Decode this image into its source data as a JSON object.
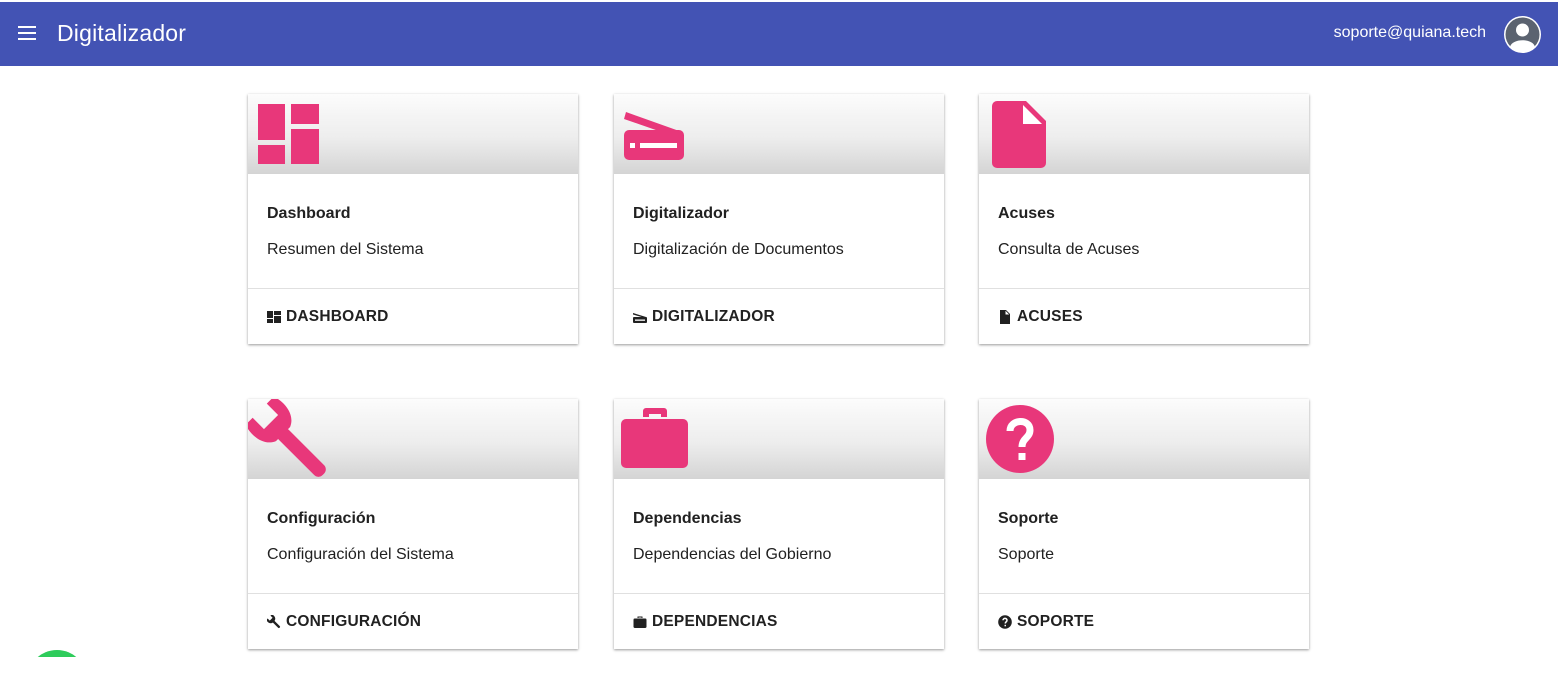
{
  "header": {
    "title": "Digitalizador",
    "user_email": "soporte@quiana.tech",
    "menu_icon": "menu-icon",
    "avatar_icon": "user-avatar-icon",
    "background": "#4353b4"
  },
  "theme": {
    "accent": "#e8377a"
  },
  "cards": [
    {
      "title": "Dashboard",
      "subtitle": "Resumen del Sistema",
      "action": "DASHBOARD",
      "icon": "dashboard-icon"
    },
    {
      "title": "Digitalizador",
      "subtitle": "Digitalización de Documentos",
      "action": "DIGITALIZADOR",
      "icon": "scanner-icon"
    },
    {
      "title": "Acuses",
      "subtitle": "Consulta de Acuses",
      "action": "ACUSES",
      "icon": "document-icon"
    },
    {
      "title": "Configuración",
      "subtitle": "Configuración del Sistema",
      "action": "CONFIGURACIÓN",
      "icon": "wrench-icon"
    },
    {
      "title": "Dependencias",
      "subtitle": "Dependencias del Gobierno",
      "action": "DEPENDENCIAS",
      "icon": "briefcase-icon"
    },
    {
      "title": "Soporte",
      "subtitle": "Soporte",
      "action": "SOPORTE",
      "icon": "help-icon"
    }
  ]
}
